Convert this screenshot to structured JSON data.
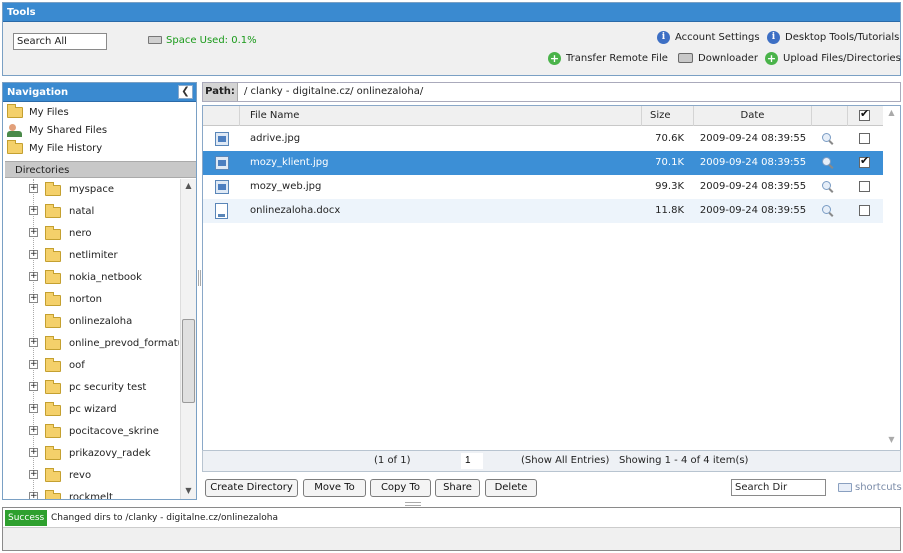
{
  "tools": {
    "title": "Tools",
    "search_value": "Search All",
    "space_used": "Space Used: 0.1%",
    "links": {
      "account_settings": "Account Settings",
      "desktop_tools": "Desktop Tools/Tutorials",
      "transfer_remote": "Transfer Remote File",
      "downloader": "Downloader",
      "upload": "Upload Files/Directories"
    }
  },
  "nav": {
    "title": "Navigation",
    "items": [
      "My Files",
      "My Shared Files",
      "My File History"
    ],
    "directories_label": "Directories",
    "tree": [
      {
        "label": "myspace",
        "expandable": true
      },
      {
        "label": "natal",
        "expandable": true
      },
      {
        "label": "nero",
        "expandable": true
      },
      {
        "label": "netlimiter",
        "expandable": true
      },
      {
        "label": "nokia_netbook",
        "expandable": true
      },
      {
        "label": "norton",
        "expandable": true
      },
      {
        "label": "onlinezaloha",
        "expandable": false
      },
      {
        "label": "online_prevod_formatu",
        "expandable": true
      },
      {
        "label": "oof",
        "expandable": true
      },
      {
        "label": "pc security test",
        "expandable": true
      },
      {
        "label": "pc wizard",
        "expandable": true
      },
      {
        "label": "pocitacove_skrine",
        "expandable": true
      },
      {
        "label": "prikazovy_radek",
        "expandable": true
      },
      {
        "label": "revo",
        "expandable": true
      },
      {
        "label": "rockmelt",
        "expandable": true
      }
    ]
  },
  "path": {
    "label": "Path:",
    "value": "/  clanky - digitalne.cz/  onlinezaloha/"
  },
  "grid": {
    "columns": {
      "name": "File Name",
      "size": "Size",
      "date": "Date"
    },
    "header_checked": true,
    "rows": [
      {
        "name": "adrive.jpg",
        "size": "70.6K",
        "date": "2009-09-24 08:39:55",
        "icon": "image-file-icon",
        "checked": false,
        "selected": false
      },
      {
        "name": "mozy_klient.jpg",
        "size": "70.1K",
        "date": "2009-09-24 08:39:55",
        "icon": "image-file-icon",
        "checked": true,
        "selected": true
      },
      {
        "name": "mozy_web.jpg",
        "size": "99.3K",
        "date": "2009-09-24 08:39:55",
        "icon": "image-file-icon",
        "checked": false,
        "selected": false
      },
      {
        "name": "onlinezaloha.docx",
        "size": "11.8K",
        "date": "2009-09-24 08:39:55",
        "icon": "document-file-icon",
        "checked": false,
        "selected": false
      }
    ]
  },
  "pager": {
    "of": "(1 of 1)",
    "page": "1",
    "show_all": "(Show All Entries)",
    "showing": "Showing 1 - 4 of 4 item(s)"
  },
  "actions": {
    "create_directory": "Create Directory",
    "move_to": "Move To",
    "copy_to": "Copy To",
    "share": "Share",
    "delete": "Delete",
    "search_dir": "Search Dir",
    "shortcuts": "shortcuts"
  },
  "status": {
    "badge": "Success",
    "message": "Changed dirs to /clanky - digitalne.cz/onlinezaloha"
  }
}
